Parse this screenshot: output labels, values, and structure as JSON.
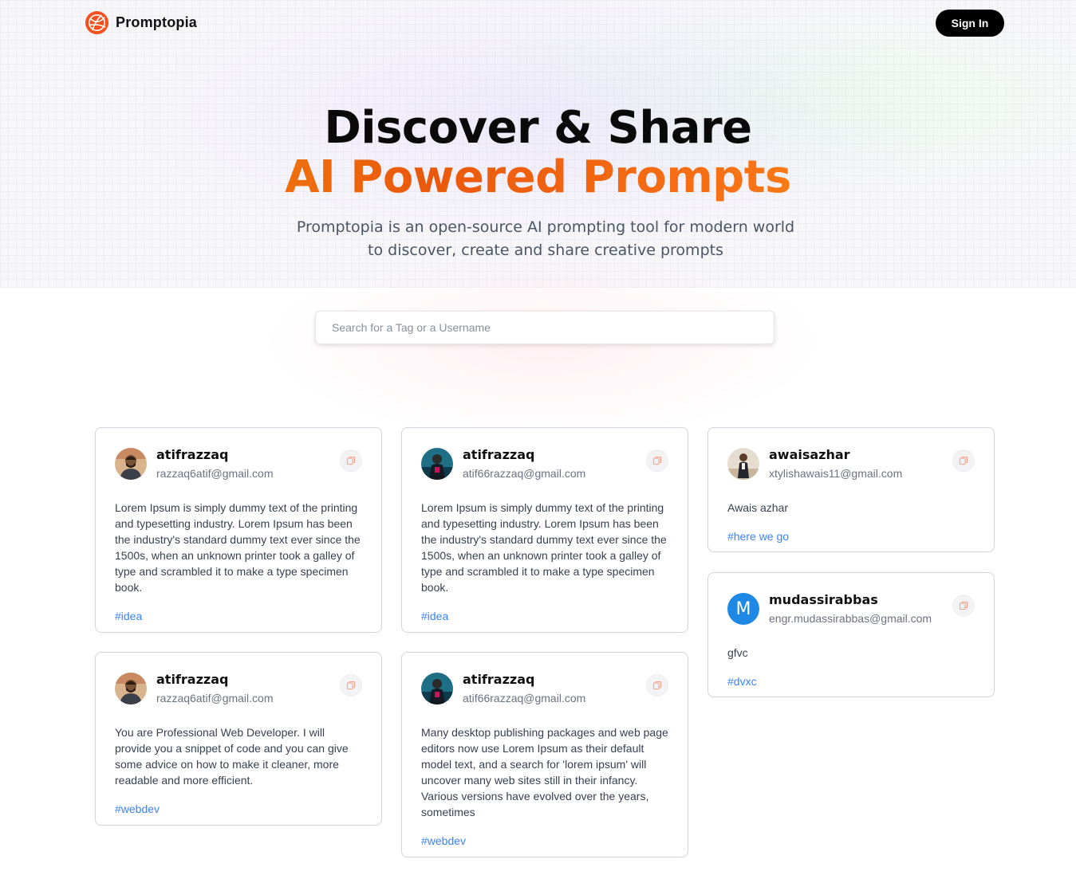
{
  "app": {
    "name": "Promptopia",
    "sign_in_label": "Sign In"
  },
  "hero": {
    "title_line1": "Discover & Share",
    "title_line2": "AI Powered Prompts",
    "subtitle": "Promptopia is an open-source AI prompting tool for modern world to discover, create and share creative prompts"
  },
  "search": {
    "placeholder": "Search for a Tag or a Username",
    "value": ""
  },
  "colors": {
    "accent_orange": "#f97316",
    "tag_blue": "#3b82f6",
    "button_black": "#000000",
    "avatar_blue": "#1e88e5"
  },
  "cards": [
    {
      "username": "atifrazzaq",
      "email": "razzaq6atif@gmail.com",
      "text": "Lorem Ipsum is simply dummy text of the printing and typesetting industry. Lorem Ipsum has been the industry's standard dummy text ever since the 1500s, when an unknown printer took a galley of type and scrambled it to make a type specimen book.",
      "tag": "#idea",
      "avatar": "photo"
    },
    {
      "username": "atifrazzaq",
      "email": "atif66razzaq@gmail.com",
      "text": "Lorem Ipsum is simply dummy text of the printing and typesetting industry. Lorem Ipsum has been the industry's standard dummy text ever since the 1500s, when an unknown printer took a galley of type and scrambled it to make a type specimen book.",
      "tag": "#idea",
      "avatar": "photo"
    },
    {
      "username": "awaisazhar",
      "email": "xtylishawais11@gmail.com",
      "text": "Awais azhar",
      "tag": "#here we go",
      "avatar": "photo"
    },
    {
      "username": "mudassirabbas",
      "email": "engr.mudassirabbas@gmail.com",
      "text": "gfvc",
      "tag": "#dvxc",
      "avatar": "M"
    },
    {
      "username": "atifrazzaq",
      "email": "razzaq6atif@gmail.com",
      "text": "You are Professional Web Developer. I will provide you a snippet of code and you can give some advice on how to make it cleaner, more readable and more efficient.",
      "tag": "#webdev",
      "avatar": "photo"
    },
    {
      "username": "atifrazzaq",
      "email": "atif66razzaq@gmail.com",
      "text": "Many desktop publishing packages and web page editors now use Lorem Ipsum as their default model text, and a search for 'lorem ipsum' will uncover many web sites still in their infancy. Various versions have evolved over the years, sometimes",
      "tag": "#webdev",
      "avatar": "photo"
    }
  ]
}
